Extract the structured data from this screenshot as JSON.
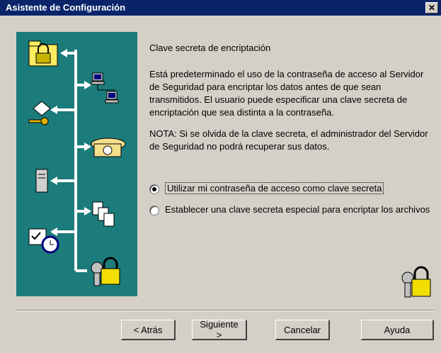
{
  "window": {
    "title": "Asistente de Configuración",
    "close_glyph": "✕"
  },
  "content": {
    "heading": "Clave secreta de encriptación",
    "description": "Está predeterminado el uso de la contraseña de acceso al Servidor de Seguridad para encriptar los datos antes de que sean transmitidos.  El usuario puede especificar una clave secreta de encriptación que sea distinta a la contraseña.",
    "note": "NOTA:  Si se olvida de la clave secreta, el administrador del Servidor de Seguridad no podrá recuperar sus datos."
  },
  "options": {
    "use_password": {
      "label": "Utilizar mi contraseña de acceso como clave secreta",
      "checked": true
    },
    "special_key": {
      "label": "Establecer una clave secreta especial para encriptar los archivos",
      "checked": false
    }
  },
  "buttons": {
    "back": "< Atrás",
    "next": "Siguiente >",
    "cancel": "Cancelar",
    "help": "Ayuda"
  },
  "colors": {
    "panel": "#1c7b7b",
    "titlebar": "#0a246a",
    "dialog": "#d4d0c8"
  },
  "icons": [
    "folder-lock-icon",
    "network-computers-icon",
    "user-key-icon",
    "telephone-icon",
    "server-icon",
    "documents-icon",
    "scheduled-task-icon",
    "keys-lock-icon"
  ]
}
